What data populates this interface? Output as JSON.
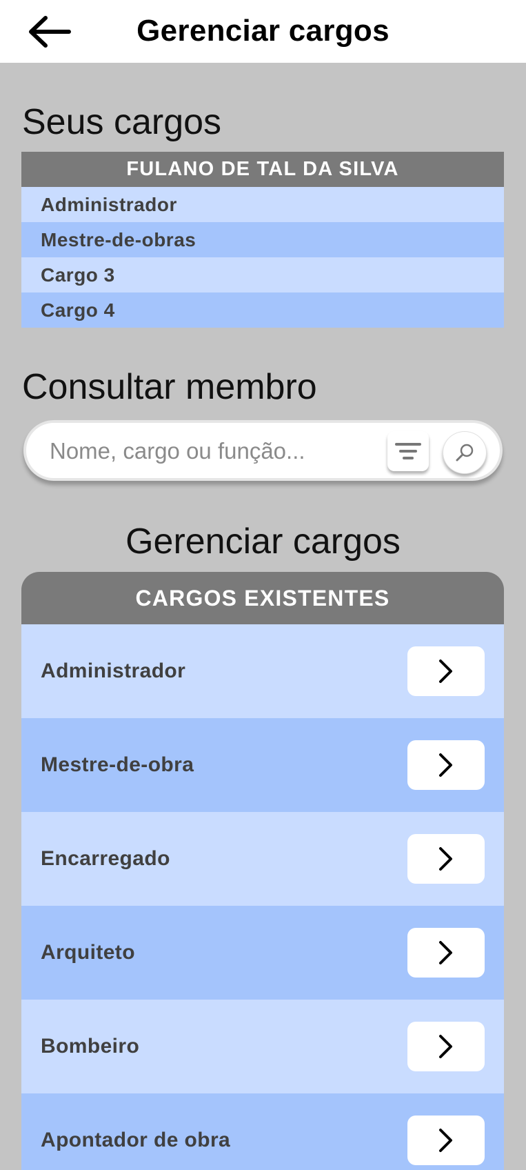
{
  "header": {
    "title": "Gerenciar cargos",
    "back_icon": "arrow-left-icon"
  },
  "my_roles": {
    "title": "Seus cargos",
    "user_name": "FULANO DE TAL DA SILVA",
    "items": [
      "Administrador",
      "Mestre-de-obras",
      "Cargo 3",
      "Cargo 4"
    ]
  },
  "search": {
    "title": "Consultar membro",
    "placeholder": "Nome, cargo ou função...",
    "value": "",
    "filter_icon": "filter-icon",
    "search_icon": "search-icon"
  },
  "manage": {
    "title": "Gerenciar cargos",
    "table_header": "CARGOS EXISTENTES",
    "items": [
      {
        "label": "Administrador"
      },
      {
        "label": "Mestre-de-obra"
      },
      {
        "label": "Encarregado"
      },
      {
        "label": "Arquiteto"
      },
      {
        "label": "Bombeiro"
      },
      {
        "label": "Apontador de obra"
      }
    ],
    "row_action_icon": "chevron-right-icon"
  },
  "colors": {
    "background": "#c4c4c4",
    "header_gray": "#7a7a7a",
    "row_light": "#c9dcff",
    "row_dark": "#a4c4fc"
  }
}
